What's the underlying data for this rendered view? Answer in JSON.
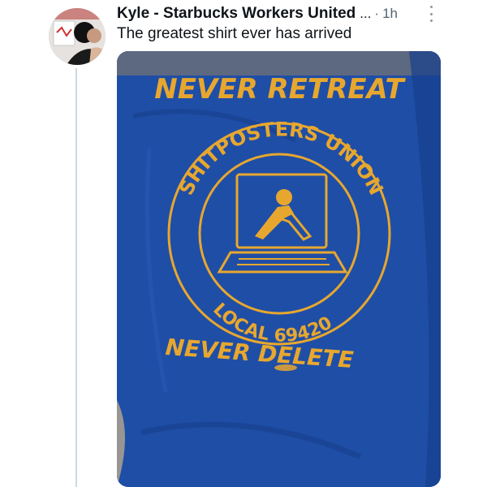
{
  "tweet": {
    "author_name": "Kyle - Starbucks Workers United",
    "name_ellipsis": "...",
    "separator": "·",
    "timestamp": "1h",
    "more_icon": "more-vertical-icon",
    "text": "The greatest shirt ever has arrived"
  },
  "shirt": {
    "top_text": "NEVER RETREAT",
    "ring_top": "SHITPOSTERS UNION",
    "ring_bottom": "LOCAL 69420",
    "bottom_text": "NEVER DELETE",
    "emblem": "arm-wrestling-hands-on-laptop",
    "colors": {
      "shirt": "#1f4ea6",
      "print": "#e7a72f"
    }
  }
}
